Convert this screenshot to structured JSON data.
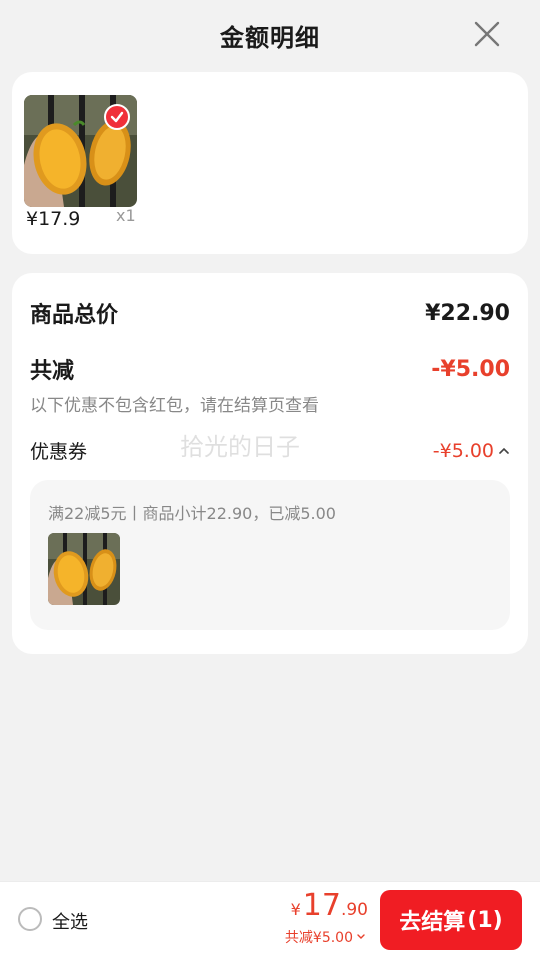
{
  "header": {
    "title": "金额明细",
    "close_icon": "close-icon"
  },
  "product": {
    "price": "¥17.9",
    "qty": "x1",
    "selected": true
  },
  "summary": {
    "goods_total_label": "商品总价",
    "goods_total_value": "¥22.90",
    "reduce_label": "共减",
    "reduce_value": "-¥5.00",
    "note": "以下优惠不包含红包，请在结算页查看",
    "coupon_label": "优惠券",
    "coupon_value": "-¥5.00",
    "watermark": "拾光的日子",
    "coupon_detail": "满22减5元丨商品小计22.90，已减5.00"
  },
  "footer": {
    "select_all_label": "全选",
    "currency": "¥",
    "total_int": "17",
    "total_dec": ".90",
    "reduce_text": "共减¥5.00",
    "checkout_label": "去结算",
    "checkout_count": "(1)"
  },
  "colors": {
    "accent": "#f01d23",
    "discount_red": "#e8402c"
  }
}
